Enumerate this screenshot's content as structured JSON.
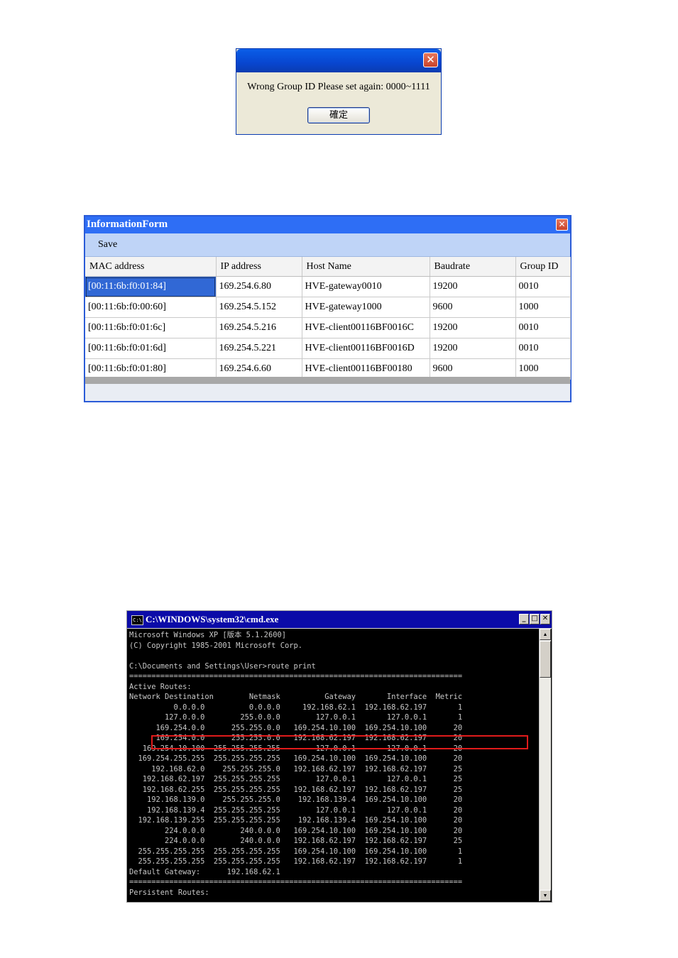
{
  "message_box": {
    "message": "Wrong Group ID Please set again: 0000~1111",
    "ok_label": "確定",
    "close_glyph": "✕"
  },
  "info_form": {
    "title": "InformationForm",
    "close_glyph": "✕",
    "menu": {
      "save_label": "Save"
    },
    "columns": [
      "MAC address",
      "IP address",
      "Host Name",
      "Baudrate",
      "Group ID"
    ],
    "rows": [
      [
        "[00:11:6b:f0:01:84]",
        "169.254.6.80",
        "HVE-gateway0010",
        "19200",
        "0010"
      ],
      [
        "[00:11:6b:f0:00:60]",
        "169.254.5.152",
        "HVE-gateway1000",
        "9600",
        "1000"
      ],
      [
        "[00:11:6b:f0:01:6c]",
        "169.254.5.216",
        "HVE-client00116BF0016C",
        "19200",
        "0010"
      ],
      [
        "[00:11:6b:f0:01:6d]",
        "169.254.5.221",
        "HVE-client00116BF0016D",
        "19200",
        "0010"
      ],
      [
        "[00:11:6b:f0:01:80]",
        "169.254.6.60",
        "HVE-client00116BF00180",
        "9600",
        "1000"
      ]
    ],
    "selected_cell": "[00:11:6b:f0:01:84]"
  },
  "cmd_window": {
    "title": "C:\\WINDOWS\\system32\\cmd.exe",
    "icon_label": "C:\\",
    "buttons": {
      "minimize": "_",
      "maximize": "□",
      "close": "✕"
    },
    "scroll_up": "▲",
    "scroll_down": "▼",
    "lines": [
      "Microsoft Windows XP [版本 5.1.2600]",
      "(C) Copyright 1985-2001 Microsoft Corp.",
      "",
      "C:\\Documents and Settings\\User>route print",
      "===========================================================================",
      "Active Routes:",
      "Network Destination        Netmask          Gateway       Interface  Metric",
      "          0.0.0.0          0.0.0.0     192.168.62.1  192.168.62.197       1",
      "        127.0.0.0        255.0.0.0        127.0.0.1       127.0.0.1       1",
      "      169.254.0.0      255.255.0.0   169.254.10.100  169.254.10.100      20",
      "      169.254.0.0      255.255.0.0   192.168.62.197  192.168.62.197      20",
      "   169.254.10.100  255.255.255.255        127.0.0.1       127.0.0.1      20",
      "  169.254.255.255  255.255.255.255   169.254.10.100  169.254.10.100      20",
      "     192.168.62.0    255.255.255.0   192.168.62.197  192.168.62.197      25",
      "   192.168.62.197  255.255.255.255        127.0.0.1       127.0.0.1      25",
      "   192.168.62.255  255.255.255.255   192.168.62.197  192.168.62.197      25",
      "    192.168.139.0    255.255.255.0    192.168.139.4  169.254.10.100      20",
      "    192.168.139.4  255.255.255.255        127.0.0.1       127.0.0.1      20",
      "  192.168.139.255  255.255.255.255    192.168.139.4  169.254.10.100      20",
      "        224.0.0.0        240.0.0.0   169.254.10.100  169.254.10.100      20",
      "        224.0.0.0        240.0.0.0   192.168.62.197  192.168.62.197      25",
      "  255.255.255.255  255.255.255.255   169.254.10.100  169.254.10.100       1",
      "  255.255.255.255  255.255.255.255   192.168.62.197  192.168.62.197       1",
      "Default Gateway:      192.168.62.1",
      "===========================================================================",
      "Persistent Routes:"
    ]
  }
}
